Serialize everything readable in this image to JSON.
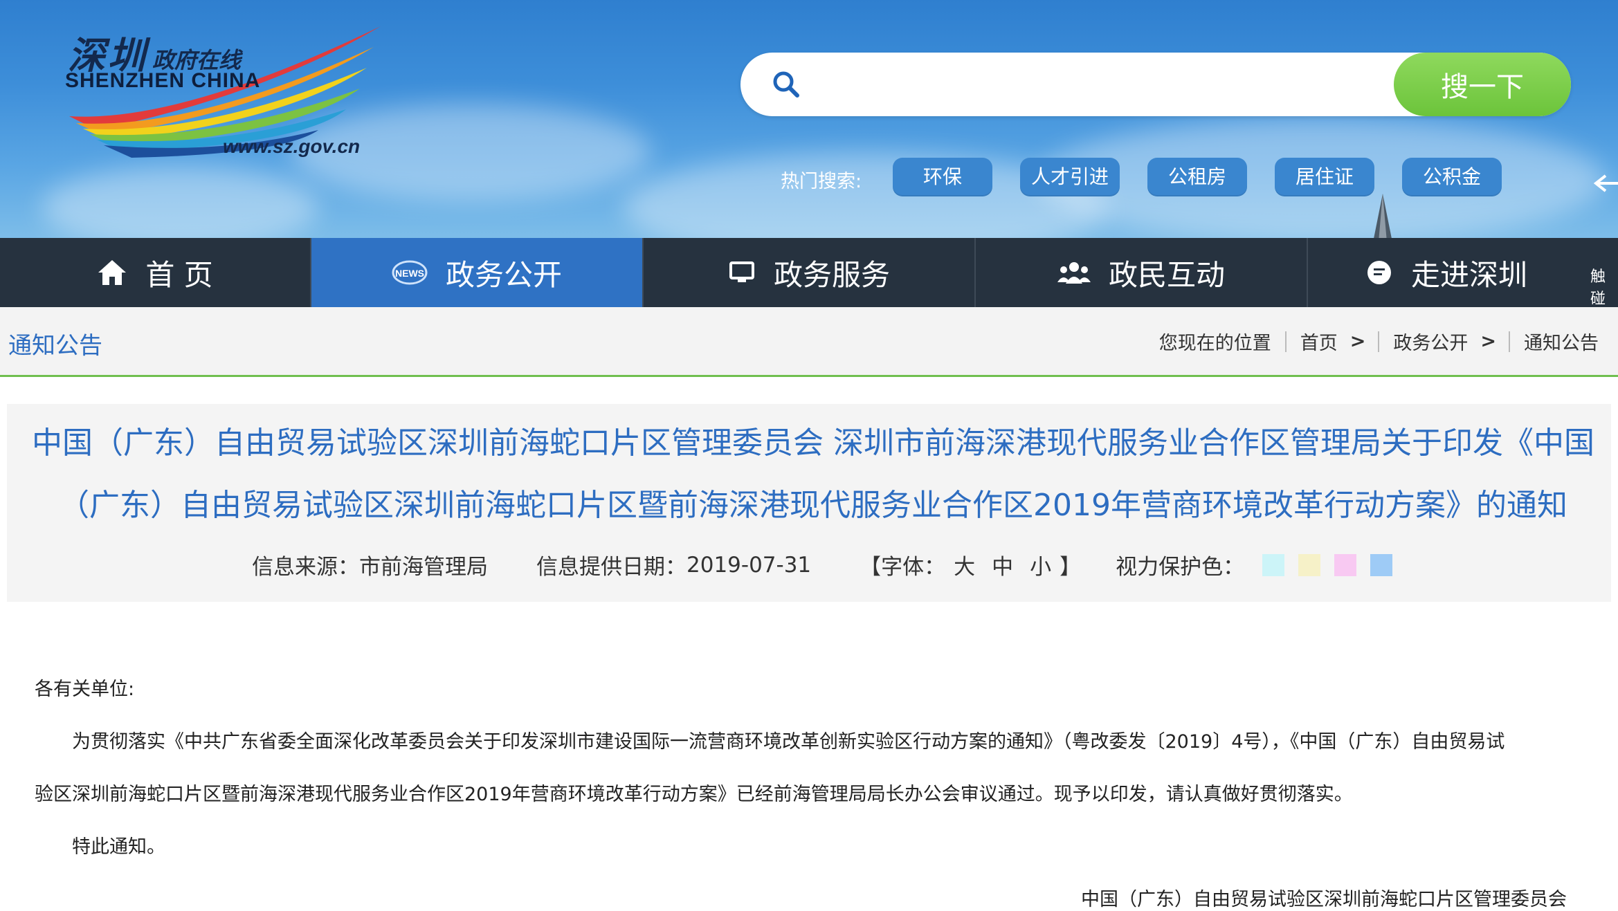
{
  "header": {
    "logo": {
      "cn": "深圳",
      "sub": "政府在线",
      "en": "SHENZHEN  CHINA",
      "url": "www.sz.gov.cn"
    },
    "search": {
      "placeholder": "",
      "button_label": "搜一下"
    },
    "hot_search": {
      "label": "热门搜索:",
      "tags": [
        "环保",
        "人才引进",
        "公租房",
        "居住证",
        "公积金"
      ]
    }
  },
  "nav": {
    "items": [
      {
        "label": "首 页",
        "icon": "home-icon"
      },
      {
        "label": "政务公开",
        "icon": "news-icon"
      },
      {
        "label": "政务服务",
        "icon": "monitor-icon"
      },
      {
        "label": "政民互动",
        "icon": "people-icon"
      },
      {
        "label": "走进深圳",
        "icon": "chat-icon"
      }
    ],
    "active_index": 1,
    "extra": "触碰"
  },
  "breadcrumb": {
    "section_title": "通知公告",
    "location_label": "您现在的位置",
    "items": [
      "首页",
      "政务公开",
      "通知公告"
    ],
    "separator": ">"
  },
  "article": {
    "title_line1": "中国（广东）自由贸易试验区深圳前海蛇口片区管理委员会 深圳市前海深港现代服务业合作区管理局关于印发《中国",
    "title_line2": "（广东）自由贸易试验区深圳前海蛇口片区暨前海深港现代服务业合作区2019年营商环境改革行动方案》的通知",
    "source_label": "信息来源：",
    "source": "市前海管理局",
    "date_label": "信息提供日期：",
    "date": "2019-07-31",
    "font_label_open": "【字体：",
    "font_sizes": [
      "大",
      "中",
      "小"
    ],
    "font_label_close": "】",
    "eye_label": "视力保护色：",
    "eye_colors": [
      "#ccf4f8",
      "#f6f1c8",
      "#f8c9f2",
      "#9ecbf6"
    ],
    "salutation": "各有关单位:",
    "para1_line1": "为贯彻落实《中共广东省委全面深化改革委员会关于印发深圳市建设国际一流营商环境改革创新实验区行动方案的通知》（粤改委发〔2019〕4号），《中国（广东）自由贸易试",
    "para1_line2": "验区深圳前海蛇口片区暨前海深港现代服务业合作区2019年营商环境改革行动方案》已经前海管理局局长办公会审议通过。现予以印发，请认真做好贯彻落实。",
    "closing": "特此通知。",
    "signature": "中国（广东）自由贸易试验区深圳前海蛇口片区管理委员会"
  },
  "colors": {
    "nav_bg": "#26323f",
    "nav_active": "#2f72c4",
    "title_blue": "#2d6dc1",
    "search_green": "#6cc43b",
    "divider_green": "#6fbf4f"
  }
}
